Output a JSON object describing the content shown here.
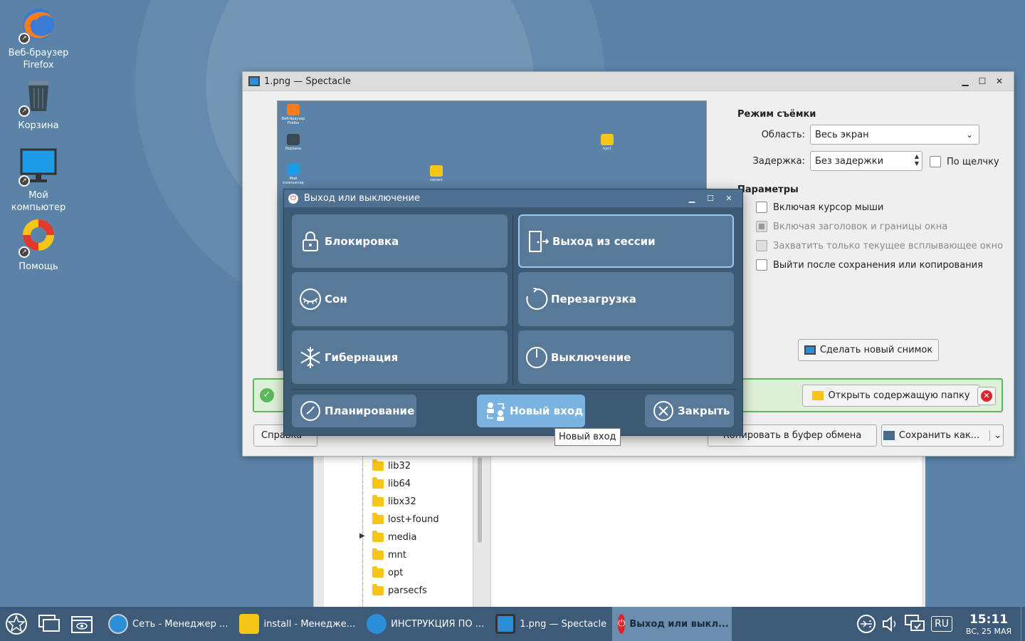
{
  "desktop": {
    "icons": [
      {
        "label": "Веб-браузер Firefox",
        "icon": "firefox-icon"
      },
      {
        "label": "Корзина",
        "icon": "trash-icon"
      },
      {
        "label": "Мой компьютер",
        "icon": "computer-icon"
      },
      {
        "label": "Помощь",
        "icon": "help-lifebuoy-icon"
      }
    ]
  },
  "file_manager_bg": {
    "tree_items": [
      "lib32",
      "lib64",
      "libx32",
      "lost+found",
      "media",
      "mnt",
      "opt",
      "parsecfs"
    ]
  },
  "spectacle": {
    "title": "1.png — Spectacle",
    "capture_mode_title": "Режим съёмки",
    "area_label": "Область:",
    "area_value": "Весь экран",
    "delay_label": "Задержка:",
    "delay_value": "Без задержки",
    "on_click_label": "По щелчку",
    "params_title": "Параметры",
    "options": [
      {
        "label": "Включая курсор мыши",
        "checked": false,
        "enabled": true
      },
      {
        "label": "Включая заголовок и границы окна",
        "checked": true,
        "enabled": false
      },
      {
        "label": "Захватить только текущее всплывающее окно",
        "checked": false,
        "enabled": false
      },
      {
        "label": "Выйти после сохранения или копирования",
        "checked": false,
        "enabled": true
      }
    ],
    "new_shot_button": "Сделать новый снимок",
    "open_folder_button": "Открыть содержащую папку",
    "footer": {
      "help": "Справка",
      "copy_clipboard": "Копировать в буфер обмена",
      "save_as": "Сохранить как..."
    },
    "preview_labels": {
      "firefox": "Веб-браузер Firefox",
      "trash": "Корзина",
      "computer": "Мой компьютер",
      "folder1": "correct",
      "folder2": "пуст"
    }
  },
  "logout_dialog": {
    "title": "Выход или выключение",
    "buttons": {
      "lock": "Блокировка",
      "logout": "Выход из сессии",
      "sleep": "Сон",
      "reboot": "Перезагрузка",
      "hibernate": "Гибернация",
      "shutdown": "Выключение",
      "schedule": "Планирование",
      "new_login": "Новый вход",
      "close": "Закрыть"
    },
    "tooltip": "Новый вход"
  },
  "taskbar": {
    "tasks": [
      {
        "label": "Сеть - Менеджер ...",
        "icon": "network-manager-icon"
      },
      {
        "label": "install - Менедже...",
        "icon": "folder-icon"
      },
      {
        "label": "ИНСТРУКЦИЯ ПО ...",
        "icon": "document-viewer-icon"
      },
      {
        "label": "1.png — Spectacle",
        "icon": "spectacle-icon"
      },
      {
        "label": "Выход или выкл...",
        "icon": "power-icon"
      }
    ],
    "language": "RU",
    "time": "15:11",
    "date": "ВС, 25 МАЯ"
  }
}
